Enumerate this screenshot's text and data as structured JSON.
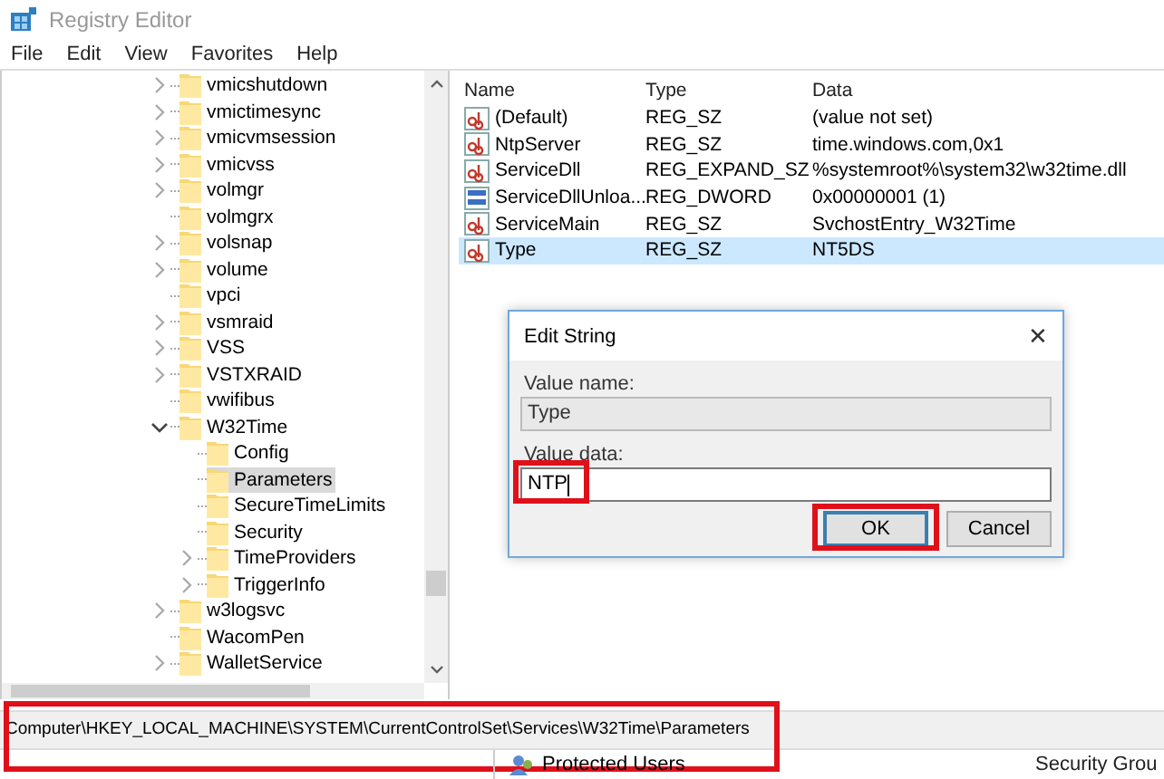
{
  "window": {
    "title": "Registry Editor"
  },
  "menu": [
    "File",
    "Edit",
    "View",
    "Favorites",
    "Help"
  ],
  "tree": [
    {
      "label": "vmicshutdown",
      "has_children": true,
      "expanded": false,
      "selected": false
    },
    {
      "label": "vmictimesync",
      "has_children": true,
      "expanded": false,
      "selected": false
    },
    {
      "label": "vmicvmsession",
      "has_children": true,
      "expanded": false,
      "selected": false
    },
    {
      "label": "vmicvss",
      "has_children": true,
      "expanded": false,
      "selected": false
    },
    {
      "label": "volmgr",
      "has_children": true,
      "expanded": false,
      "selected": false
    },
    {
      "label": "volmgrx",
      "has_children": false,
      "selected": false
    },
    {
      "label": "volsnap",
      "has_children": true,
      "expanded": false,
      "selected": false
    },
    {
      "label": "volume",
      "has_children": true,
      "expanded": false,
      "selected": false
    },
    {
      "label": "vpci",
      "has_children": false,
      "selected": false
    },
    {
      "label": "vsmraid",
      "has_children": true,
      "expanded": false,
      "selected": false
    },
    {
      "label": "VSS",
      "has_children": true,
      "expanded": false,
      "selected": false
    },
    {
      "label": "VSTXRAID",
      "has_children": true,
      "expanded": false,
      "selected": false
    },
    {
      "label": "vwifibus",
      "has_children": false,
      "selected": false
    },
    {
      "label": "W32Time",
      "has_children": true,
      "expanded": true,
      "selected": false,
      "children": [
        {
          "label": "Config",
          "has_children": false,
          "selected": false
        },
        {
          "label": "Parameters",
          "has_children": false,
          "selected": true
        },
        {
          "label": "SecureTimeLimits",
          "has_children": false,
          "selected": false
        },
        {
          "label": "Security",
          "has_children": false,
          "selected": false
        },
        {
          "label": "TimeProviders",
          "has_children": true,
          "expanded": false,
          "selected": false
        },
        {
          "label": "TriggerInfo",
          "has_children": true,
          "expanded": false,
          "selected": false
        }
      ]
    },
    {
      "label": "w3logsvc",
      "has_children": true,
      "expanded": false,
      "selected": false
    },
    {
      "label": "WacomPen",
      "has_children": false,
      "selected": false
    },
    {
      "label": "WalletService",
      "has_children": true,
      "expanded": false,
      "selected": false
    }
  ],
  "values": {
    "columns": [
      "Name",
      "Type",
      "Data"
    ],
    "rows": [
      {
        "kind": "string",
        "name": "(Default)",
        "type": "REG_SZ",
        "data": "(value not set)",
        "selected": false
      },
      {
        "kind": "string",
        "name": "NtpServer",
        "type": "REG_SZ",
        "data": "time.windows.com,0x1",
        "selected": false
      },
      {
        "kind": "string",
        "name": "ServiceDll",
        "type": "REG_EXPAND_SZ",
        "data": "%systemroot%\\system32\\w32time.dll",
        "selected": false
      },
      {
        "kind": "dword",
        "name": "ServiceDllUnloa...",
        "type": "REG_DWORD",
        "data": "0x00000001 (1)",
        "selected": false
      },
      {
        "kind": "string",
        "name": "ServiceMain",
        "type": "REG_SZ",
        "data": "SvchostEntry_W32Time",
        "selected": false
      },
      {
        "kind": "string",
        "name": "Type",
        "type": "REG_SZ",
        "data": "NT5DS",
        "selected": true
      }
    ]
  },
  "dialog": {
    "title": "Edit String",
    "close": "✕",
    "name_label": "Value name:",
    "name_value": "Type",
    "data_label": "Value data:",
    "data_value": "NTP",
    "data_highlighted": true,
    "buttons": [
      {
        "label": "OK",
        "default": true,
        "highlighted": true
      },
      {
        "label": "Cancel",
        "default": false,
        "highlighted": false
      }
    ]
  },
  "status_bar": {
    "path": "Computer\\HKEY_LOCAL_MACHINE\\SYSTEM\\CurrentControlSet\\Services\\W32Time\\Parameters",
    "highlighted": true
  },
  "background_window": {
    "rows": [
      {
        "name": "Protected Users",
        "type": "Security Grou"
      }
    ]
  }
}
